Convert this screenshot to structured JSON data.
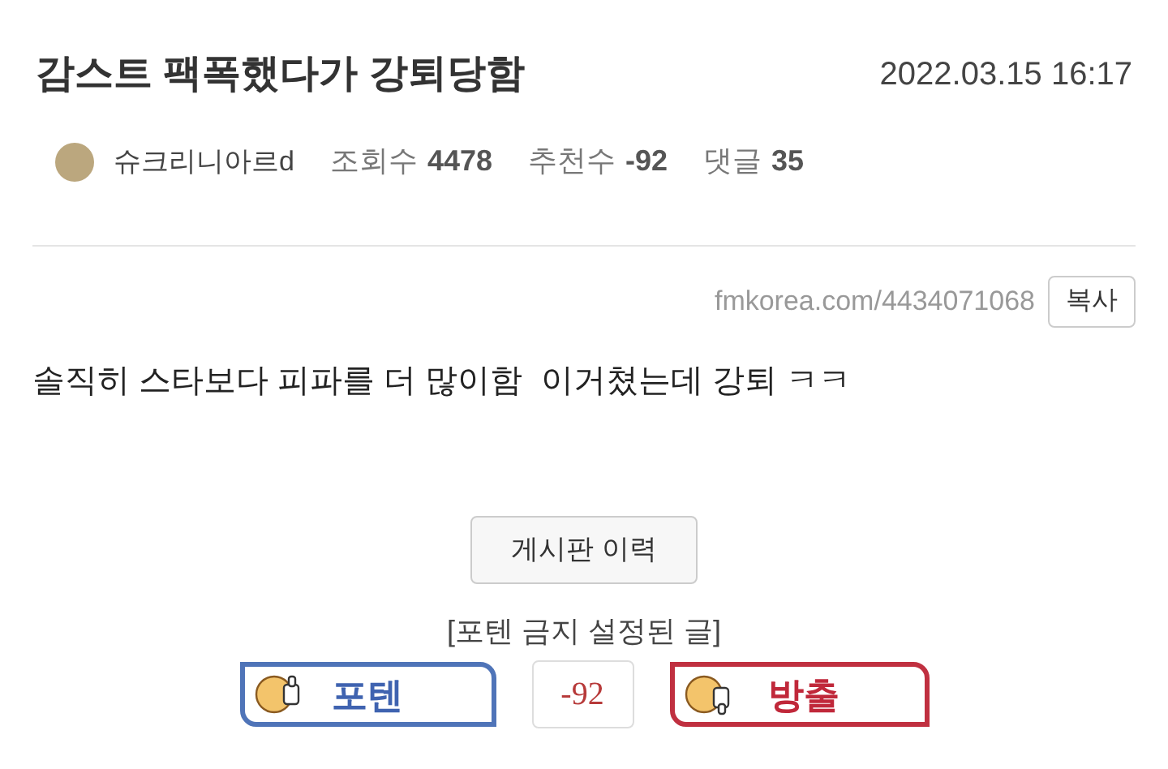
{
  "post": {
    "title": "감스트 팩폭했다가 강퇴당함",
    "date": "2022.03.15 16:17",
    "author": "슈크리니아르d",
    "stats": [
      {
        "label": "조회수",
        "value": "4478"
      },
      {
        "label": "추천수",
        "value": "-92"
      },
      {
        "label": "댓글",
        "value": "35"
      }
    ],
    "url": "fmkorea.com/4434071068",
    "copy_button": "복사",
    "body": "솔직히 스타보다 피파를 더 많이함  이거쳤는데 강퇴 ㅋㅋ",
    "history_button": "게시판 이력",
    "notice": "[포텐 금지 설정된 글]",
    "vote": {
      "up": "포텐",
      "score": "-92",
      "down": "방출"
    }
  }
}
